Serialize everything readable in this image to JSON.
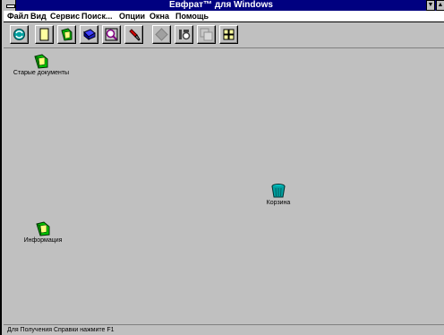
{
  "window": {
    "title": "Евфрат™ для Windows"
  },
  "menu": [
    "Файл",
    "Вид",
    "Сервис",
    "Поиск...",
    "Опции",
    "Окна",
    "Помощь"
  ],
  "toolbar": {
    "icons": [
      "refresh-icon",
      "new-document-icon",
      "open-folder-icon",
      "book-icon",
      "search-icon",
      "flashlight-icon",
      "disabled-diamond-icon",
      "print-icon",
      "copy-icon",
      "grid-icon"
    ]
  },
  "desktop": {
    "icons": [
      {
        "label": "Старые документы",
        "icon": "folder-icon"
      },
      {
        "label": "Корзина",
        "icon": "trash-icon"
      },
      {
        "label": "Информация",
        "icon": "folder-icon"
      }
    ]
  },
  "status": {
    "text": "Для Получения Справки нажмите F1"
  },
  "colors": {
    "title_bg": "#000080",
    "workspace": "#c0c0c0"
  }
}
